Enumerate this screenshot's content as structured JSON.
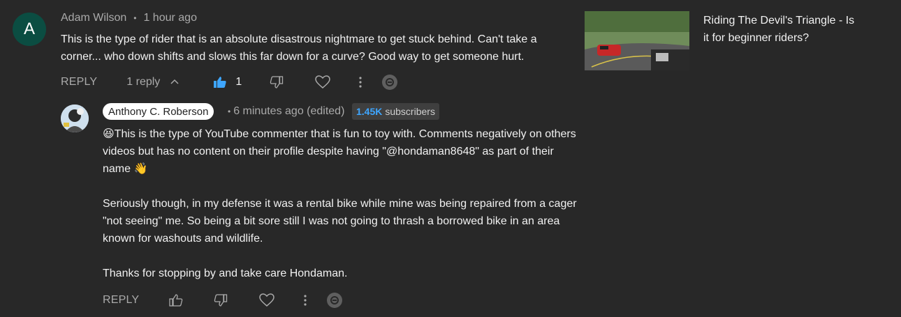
{
  "comment": {
    "avatar_letter": "A",
    "author": "Adam Wilson",
    "time": "1 hour ago",
    "text": "This is the type of rider that is an absolute disastrous nightmare to get stuck behind. Can't take a corner... who down shifts and slows this far down for a curve? Good way to get someone hurt.",
    "reply_label": "REPLY",
    "replies_label": "1 reply",
    "like_count": "1"
  },
  "reply": {
    "author": "Anthony C. Roberson",
    "time": "6 minutes ago (edited)",
    "subs_count": "1.45K",
    "subs_label": "subscribers",
    "para1": "😆This is the type of YouTube commenter that is fun to toy with. Comments negatively on others videos but has no content on their profile despite having \"@hondaman8648\" as part of their name 👋",
    "para2": "Seriously though, in my defense it was a rental bike while mine was being repaired from a cager \"not seeing\" me. So being a bit sore still I was not going to thrash a borrowed bike in an area known for washouts and wildlife.",
    "para3": "Thanks for stopping by and take care Hondaman.",
    "reply_label": "REPLY"
  },
  "sidebar": {
    "video_title": "Riding The Devil's Triangle - Is it for beginner riders?"
  },
  "colors": {
    "background": "#282828",
    "avatar_bg": "#0b4d42",
    "liked_blue": "#3ea6ff",
    "muted_text": "#aaaaaa"
  },
  "icons": [
    "chevron-up-icon",
    "thumbs-up-icon",
    "thumbs-down-icon",
    "heart-icon",
    "more-vert-icon",
    "extension-badge-icon"
  ]
}
